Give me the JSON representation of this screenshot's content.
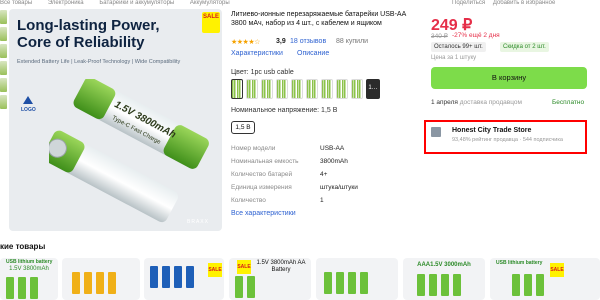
{
  "breadcrumb": [
    "Все товары",
    "Электроника",
    "Батарейки и аккумуляторы",
    "Аккумуляторы"
  ],
  "breadcrumb_right": [
    "Поделиться",
    "Добавить в избранное"
  ],
  "hero": {
    "title_line1": "Long-lasting Power,",
    "title_line2": "Core of Reliability",
    "subtitle": "Extended Battery Life | Leak-Proof Technology | Wide Compatibility",
    "logo": "LOGO",
    "sale_badge": "SALE",
    "brand": "BRAXX",
    "battery_text": "1.5V 3800mAh",
    "battery_subtext": "Type-C Fast Charge"
  },
  "product": {
    "title": "Литиево-ионные перезаряжаемые батарейки USB-AA 3800 мАч, набор из 4 шт., с кабелем и ящиком",
    "stars": "★★★★☆",
    "rating": "3,9",
    "reviews": "18 отзывов",
    "bought": "88 купили",
    "tab_specs": "Характеристики",
    "tab_desc": "Описание",
    "color_label": "Цвет: 1pc usb cable",
    "swatch_more": "1…",
    "voltage_label": "Номинальное напряжение: 1,5 В",
    "voltage_value": "1,5 В",
    "specs": [
      {
        "name": "Номер модели",
        "value": "USB-AA"
      },
      {
        "name": "Номинальная емкость",
        "value": "3800mAh"
      },
      {
        "name": "Количество батарей",
        "value": "4+"
      },
      {
        "name": "Единица измерения",
        "value": "штука/штуки"
      },
      {
        "name": "Количество",
        "value": "1"
      }
    ],
    "all_specs": "Все характеристики"
  },
  "purchase": {
    "price": "249 ₽",
    "old_price": "340 ₽",
    "discount_text": "-27% ещё 2 дня",
    "stock": "Осталось 99+ шт.",
    "extra_discount": "Скидка от 2 шт.",
    "unit_price": "Цена за 1 штуку",
    "cart_button": "В корзину",
    "delivery_date": "1 апреля",
    "delivery_by": "доставка продавцом",
    "delivery_cost": "Бесплатно"
  },
  "seller": {
    "name": "Honest City Trade Store",
    "rating": "93,48% рейтинг продавца",
    "subscribers": "544 подписчика"
  },
  "similar": {
    "title": "кие товары",
    "cards": [
      {
        "tag": "USB lithium battery",
        "text": "1.5V 3800mAh",
        "sale": ""
      },
      {
        "tag": "",
        "text": "",
        "sale": ""
      },
      {
        "tag": "",
        "text": "",
        "sale": "SALE"
      },
      {
        "tag": "",
        "text": "1.5V 3800mAh AA Battery",
        "sale": "SALE"
      },
      {
        "tag": "",
        "text": "",
        "sale": ""
      },
      {
        "tag": "",
        "text": "AAA1.5V 3000mAh",
        "sale": ""
      },
      {
        "tag": "USB lithium battery",
        "text": "",
        "sale": "SALE"
      }
    ]
  },
  "colors": {
    "price": "#e52e48",
    "accent_link": "#2e62d1",
    "cart_button": "#7ddc4a",
    "highlight_box": "#ff0000",
    "free": "#2b8a27"
  },
  "icons": [
    "store-icon"
  ]
}
